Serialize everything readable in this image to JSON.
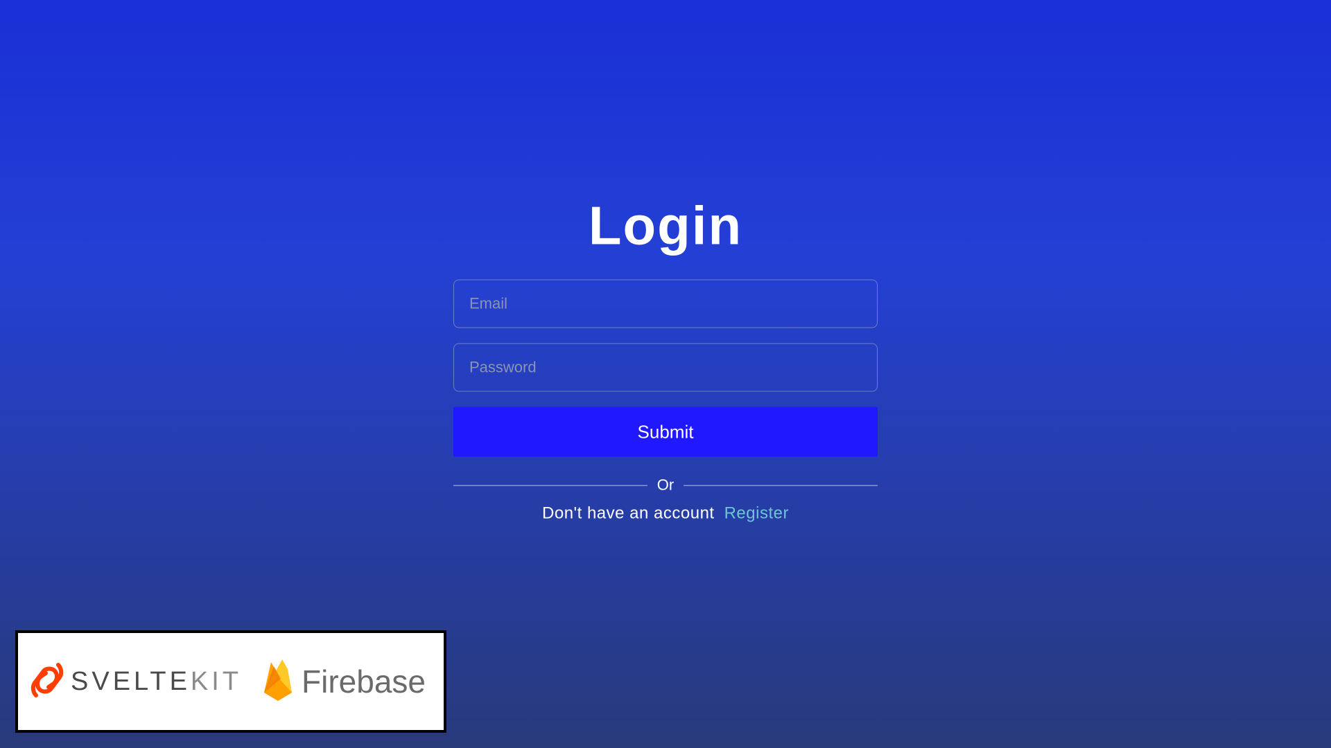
{
  "login": {
    "title": "Login",
    "email_placeholder": "Email",
    "password_placeholder": "Password",
    "submit_label": "Submit",
    "divider_text": "Or",
    "register_prompt": "Don't have an account",
    "register_link": "Register"
  },
  "badge": {
    "sveltekit_bold": "SVELTE",
    "sveltekit_light": "KIT",
    "firebase": "Firebase"
  },
  "colors": {
    "gradient_top": "#1a2fd6",
    "gradient_bottom": "#283a7a",
    "submit_bg": "#2019ff",
    "register_link": "#6ec5d4",
    "svelte_orange": "#ff3e00",
    "firebase_yellow": "#ffca28",
    "firebase_orange": "#ffa000"
  }
}
